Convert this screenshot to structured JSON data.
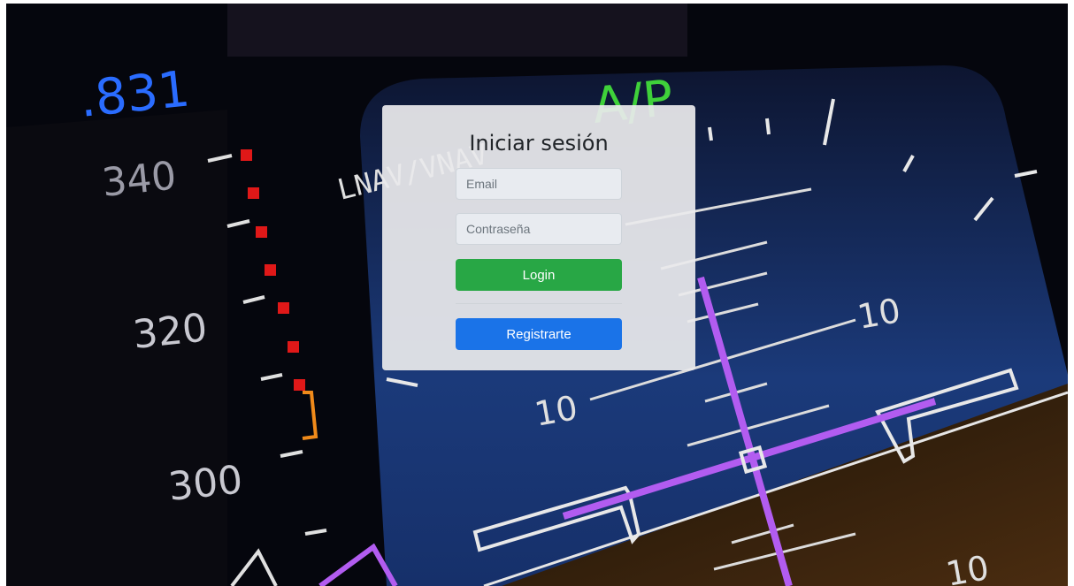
{
  "login": {
    "title": "Iniciar sesión",
    "email_placeholder": "Email",
    "password_placeholder": "Contraseña",
    "login_label": "Login",
    "register_label": "Registrarte"
  },
  "background": {
    "speed_tape": [
      "340",
      "320",
      "300"
    ],
    "mach": ".831",
    "autopilot": "A/P",
    "nav_mode": "LNAV/VNAV",
    "pitch_labels": [
      "10",
      "10",
      "10"
    ]
  },
  "colors": {
    "login_button": "#28a745",
    "register_button": "#1a73e8",
    "card": "#e9eaec"
  }
}
